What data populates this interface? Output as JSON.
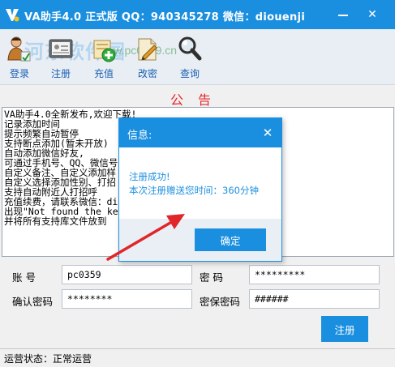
{
  "window": {
    "title": "VA助手4.0 正式版 QQ：940345278 微信：diouenji",
    "minimize_glyph": "",
    "close_glyph": "✕"
  },
  "watermark": {
    "text1": "河东软件园",
    "text2": "www.pc0359.cn"
  },
  "toolbar": {
    "items": [
      {
        "label": "登录",
        "icon": "user-login-icon"
      },
      {
        "label": "注册",
        "icon": "register-card-icon"
      },
      {
        "label": "充值",
        "icon": "recharge-plus-icon"
      },
      {
        "label": "改密",
        "icon": "edit-document-icon"
      },
      {
        "label": "查询",
        "icon": "magnifier-icon"
      }
    ]
  },
  "announcement": {
    "title": "公告",
    "lines": [
      "VA助手4.0全新发布,欢迎下载!",
      "记录添加时间",
      "提示频繁自动暂停",
      "支持断点添加(暂未开放)",
      "自动添加微信好友,",
      "可通过手机号、QQ、微信号",
      "自定义备注、自定义添加样",
      "自定义选择添加性别、打招",
      "支持自动附近人打招呼",
      "充值续费，请联系微信：di",
      "出现\"Not found the kern                    持库文件,",
      " 并将所有支持库文件放到"
    ]
  },
  "form": {
    "account_label": "账  号",
    "account_value": "pc0359",
    "password_label": "密  码",
    "password_value": "*********",
    "confirm_label": "确认密码",
    "confirm_value": "********",
    "security_label": "密保密码",
    "security_value": "######",
    "register_button": "注册"
  },
  "status": {
    "text": "运营状态：正常运营"
  },
  "dialog": {
    "title": "信息:",
    "close_glyph": "✕",
    "message1": "注册成功!",
    "message2": "本次注册赠送您时间：360分钟",
    "ok_button": "确定"
  },
  "colors": {
    "accent": "#1b8fdf",
    "announce_title": "#e8262a",
    "arrow": "#e0262a"
  }
}
